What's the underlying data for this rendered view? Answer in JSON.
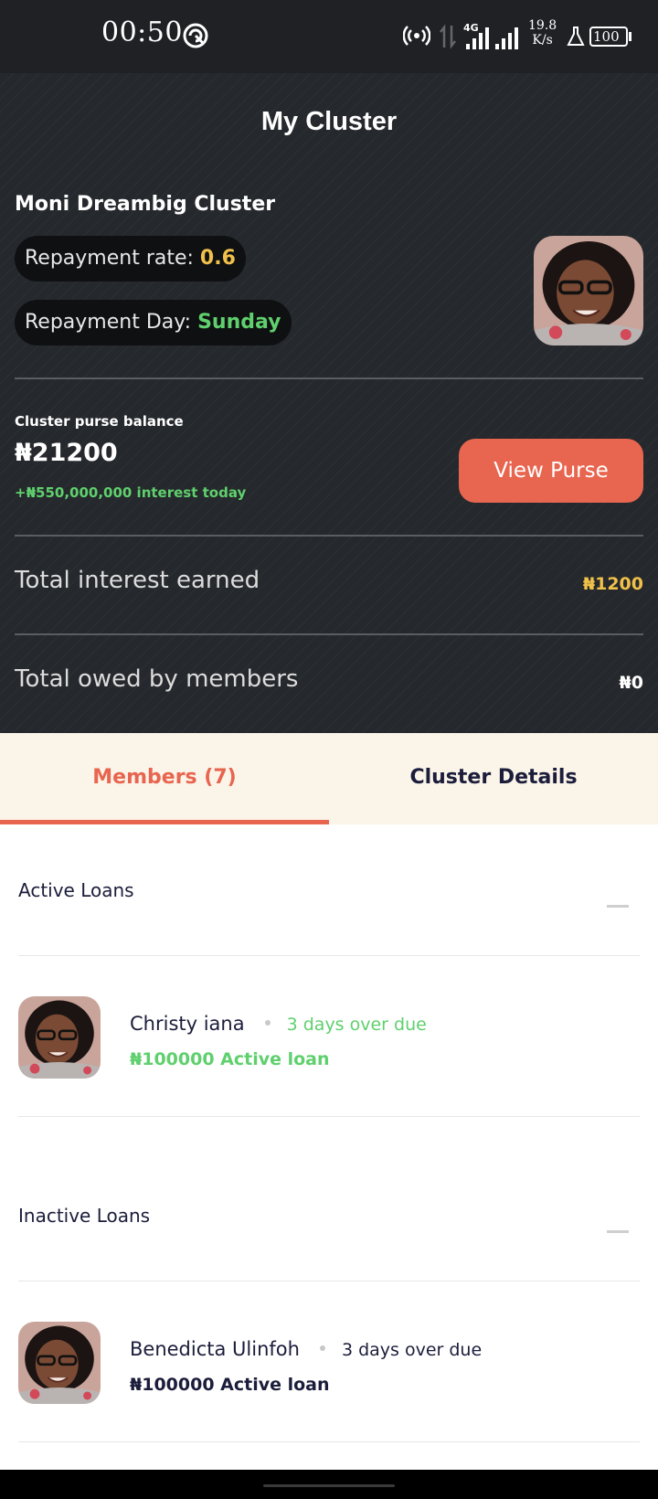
{
  "status_bar": {
    "time": "00:50",
    "network": "4G",
    "speed_value": "19.8",
    "speed_unit": "K/s",
    "battery": "100"
  },
  "header": {
    "title": "My Cluster",
    "cluster_name": "Moni Dreambig Cluster",
    "repayment_rate_label": "Repayment rate: ",
    "repayment_rate_value": "0.6",
    "repayment_day_label": "Repayment Day: ",
    "repayment_day_value": "Sunday"
  },
  "purse": {
    "label": "Cluster purse balance",
    "amount": "₦21200",
    "interest_today": "+₦550,000,000 interest today",
    "button_label": "View Purse"
  },
  "stats": {
    "interest_label": "Total interest earned",
    "interest_value": "₦1200",
    "owed_label": "Total owed by members",
    "owed_value": "₦0"
  },
  "tabs": {
    "members": "Members (7)",
    "details": "Cluster Details"
  },
  "active_loans": {
    "title": "Active Loans",
    "items": [
      {
        "name": "Christy iana",
        "due": "3 days over due",
        "loan": "₦100000 Active loan"
      }
    ]
  },
  "inactive_loans": {
    "title": "Inactive Loans",
    "items": [
      {
        "name": "Benedicta Ulinfoh",
        "due": "3 days over due",
        "loan": "₦100000 Active loan"
      }
    ]
  },
  "colors": {
    "accent": "#e8654f",
    "green": "#5fd06d",
    "yellow": "#f0c04a",
    "dark_bg": "#25282c",
    "navy": "#1b1d3b"
  }
}
